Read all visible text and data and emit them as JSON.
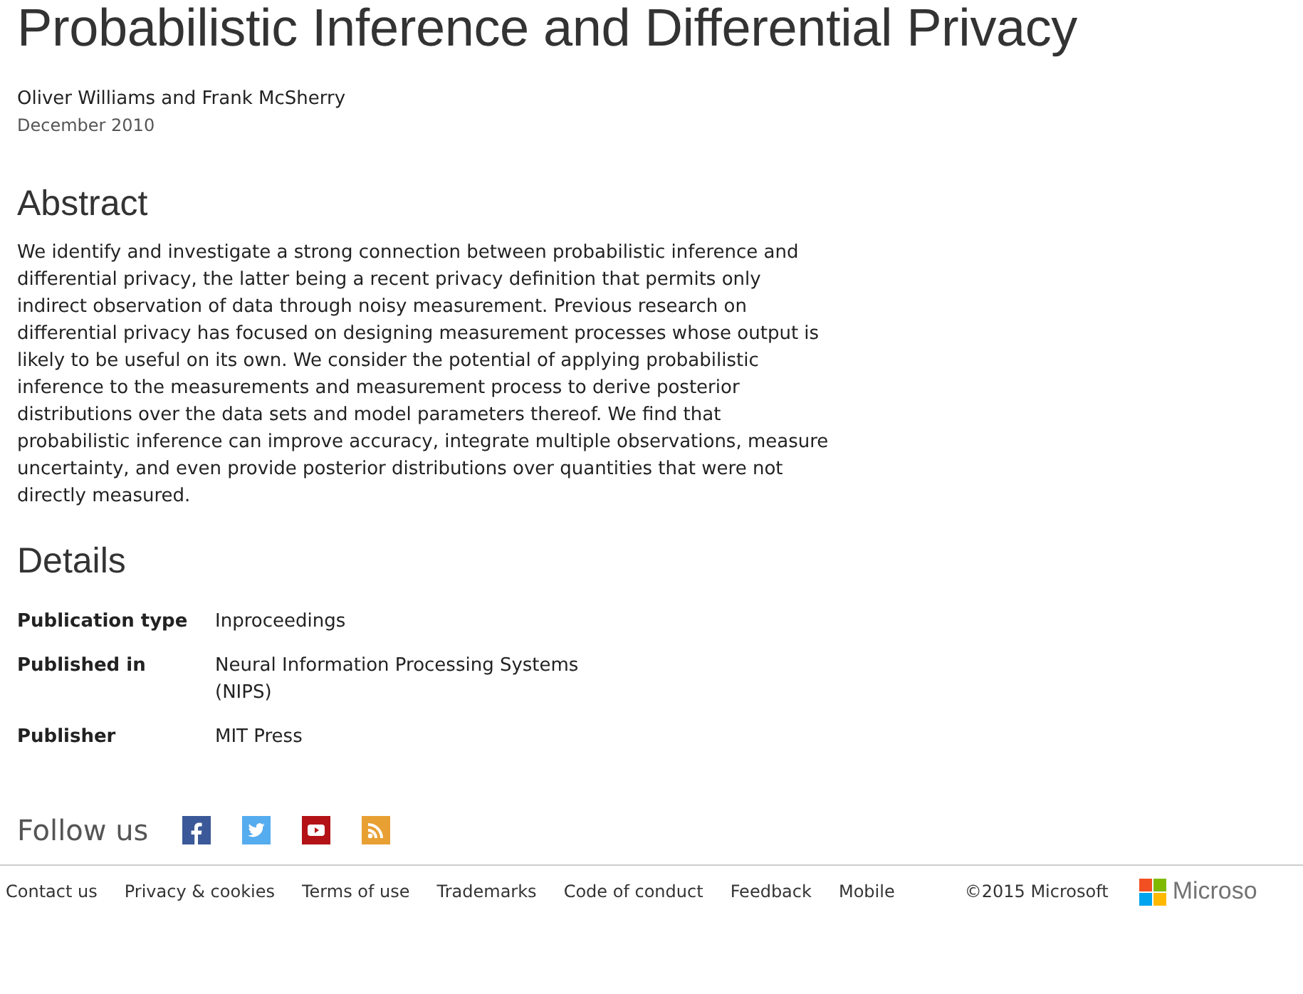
{
  "title": "Probabilistic Inference and Differential Privacy",
  "authors": "Oliver Williams and Frank McSherry",
  "date": "December 2010",
  "abstract": {
    "heading": "Abstract",
    "text": "We identify and investigate a strong connection between probabilistic inference and differential privacy, the latter being a recent privacy definition that permits only indirect observation of data through noisy measurement. Previous research on differential privacy has focused on designing measurement processes whose output is likely to be useful on its own. We consider the potential of applying probabilistic inference to the measurements and measurement process to derive posterior distributions over the data sets and model parameters thereof. We find that probabilistic inference can improve accuracy, integrate multiple observations, measure uncertainty, and even provide posterior distributions over quantities that were not directly measured."
  },
  "details": {
    "heading": "Details",
    "rows": [
      {
        "label": "Publication type",
        "value": "Inproceedings"
      },
      {
        "label": "Published in",
        "value": "Neural Information Processing Systems (NIPS)"
      },
      {
        "label": "Publisher",
        "value": "MIT Press"
      }
    ]
  },
  "follow": {
    "label": "Follow us",
    "icons": [
      {
        "kind": "facebook"
      },
      {
        "kind": "twitter"
      },
      {
        "kind": "youtube"
      },
      {
        "kind": "rss"
      }
    ]
  },
  "footer": {
    "links": [
      "Contact us",
      "Privacy & cookies",
      "Terms of use",
      "Trademarks",
      "Code of conduct",
      "Feedback",
      "Mobile"
    ],
    "copyright": "©2015 Microsoft",
    "logo_text": "Microso"
  }
}
